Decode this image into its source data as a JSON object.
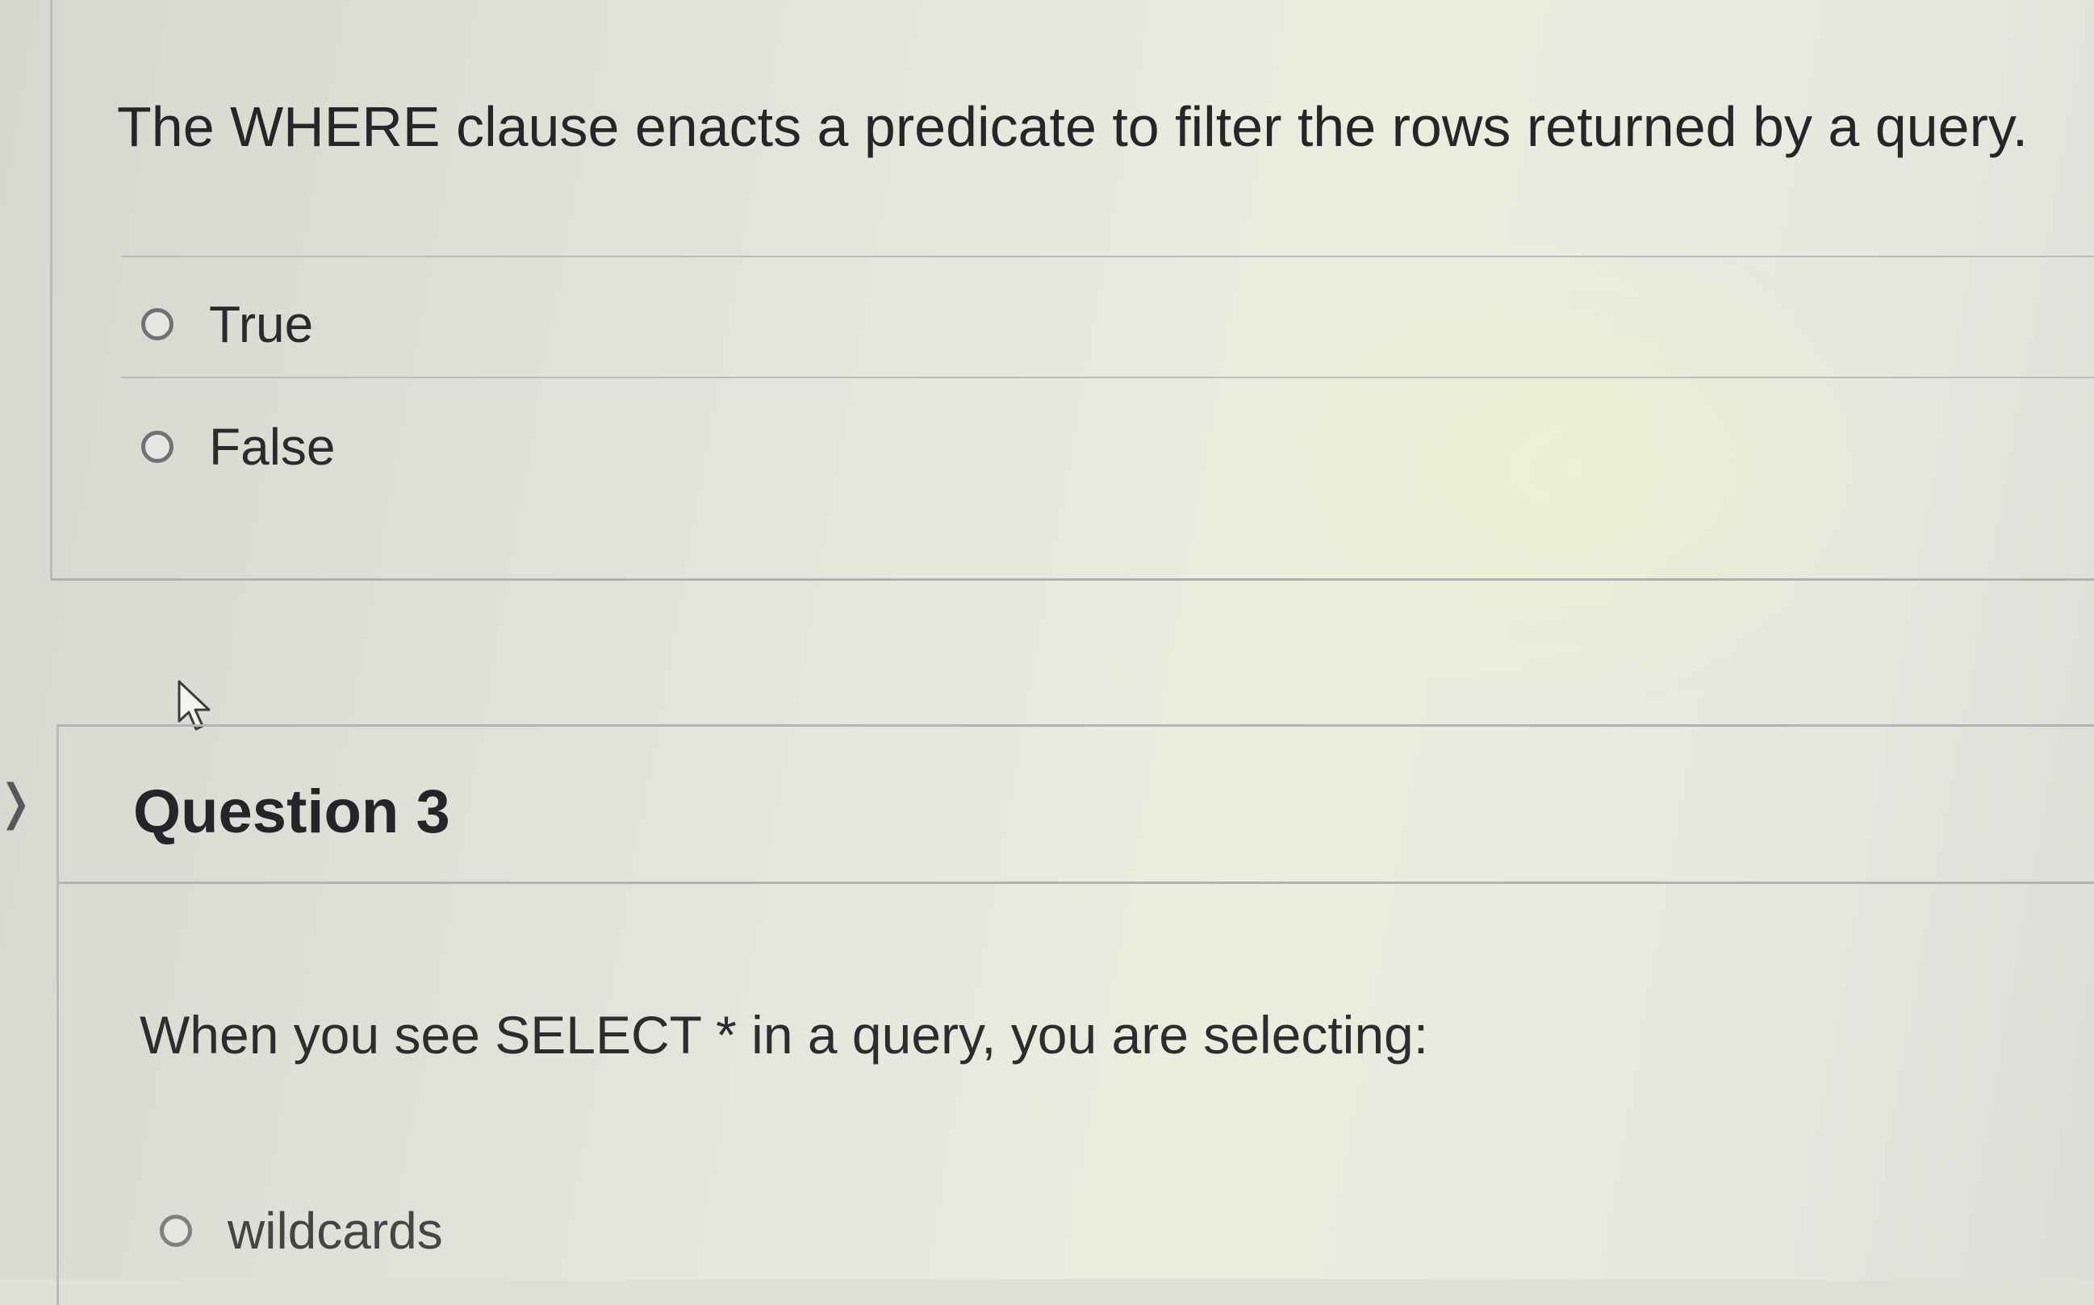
{
  "question2": {
    "text": "The WHERE clause enacts a predicate to filter the rows returned by a query.",
    "options": [
      {
        "label": "True",
        "selected": false
      },
      {
        "label": "False",
        "selected": false
      }
    ]
  },
  "question3": {
    "title": "Question 3",
    "text": "When you see SELECT * in a query, you are selecting:",
    "options": [
      {
        "label": "wildcards",
        "selected": false
      }
    ]
  },
  "icons": {
    "collapse_arrow": "chevron-right-icon",
    "cursor": "mouse-pointer-icon"
  },
  "colors": {
    "background": "#e0e1d9",
    "text": "#2a2b2f",
    "border": "#b1b4b6",
    "radio_border": "#6f7276"
  }
}
